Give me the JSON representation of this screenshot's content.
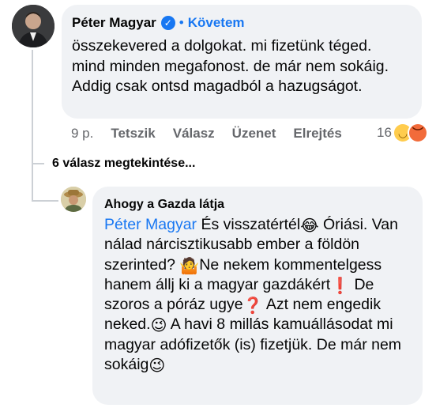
{
  "comment": {
    "author": "Péter Magyar",
    "verified_icon": "verified-badge-icon",
    "separator": "•",
    "follow_label": "Követem",
    "text": "összekevered a dolgokat. mi fizetünk téged. mind minden megafonost. de már nem sokáig. Addig csak ontsd magadból a hazugságot.",
    "actions": {
      "time": "9 p.",
      "like": "Tetszik",
      "reply": "Válasz",
      "message": "Üzenet",
      "hide": "Elrejtés"
    },
    "reaction_count": "16",
    "reactions": [
      "laughing-emoji-icon",
      "angry-emoji-icon"
    ]
  },
  "view_replies": "6 válasz megtekintése...",
  "reply": {
    "author": "Ahogy a Gazda látja",
    "mention": "Péter Magyar",
    "segments": [
      " És visszatértél",
      "Óriási. Van nálad nárcisztikusabb ember a földön szerinted? ",
      "Ne nekem kommentelgess hanem állj ki a magyar gazdákért",
      "  De szoros a póráz ugye",
      "  Azt nem engedik neked.",
      "  A havi 8 millás kamuállásodat mi magyar adófizetők (is) fizetjük. De már nem sokáig"
    ],
    "emojis": [
      "😂",
      "🤷",
      "❗",
      "❓",
      "😉",
      "😉"
    ],
    "colors": {
      "accent": "#1877f2",
      "bubble": "#f0f2f5",
      "muted": "#65676b",
      "warning": "#e02020"
    }
  }
}
